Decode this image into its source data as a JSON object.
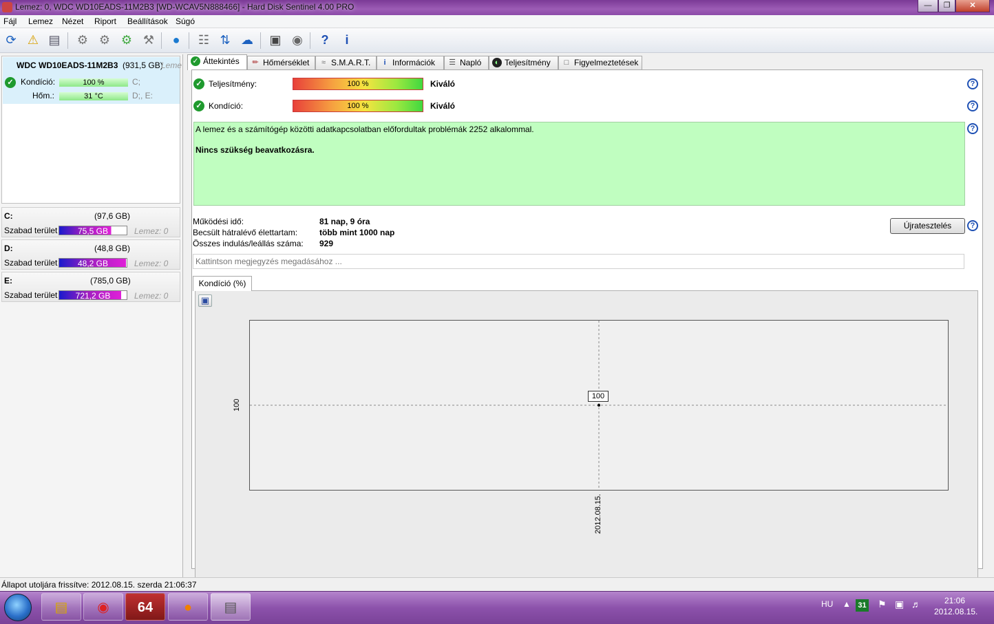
{
  "window": {
    "title": "Lemez: 0, WDC WD10EADS-11M2B3 [WD-WCAV5N888466]  -  Hard Disk Sentinel 4.00 PRO"
  },
  "menu": [
    "Fájl",
    "Lemez",
    "Nézet",
    "Riport",
    "Beállítások",
    "Súgó"
  ],
  "toolbar_icons": [
    "refresh-icon",
    "warning-icon",
    "disk-icon",
    "disk-settings-icon",
    "disk-test-icon",
    "disk-check-icon",
    "disk-repair-icon",
    "globe-icon",
    "report-icon",
    "sync-icon",
    "network-icon",
    "monitor-icon",
    "sound-icon",
    "help-icon",
    "info-icon"
  ],
  "disk": {
    "name": "WDC WD10EADS-11M2B3",
    "size": "(931,5 GB)",
    "size_suffix": "Leme",
    "health_label": "Kondíció:",
    "health_value": "100 %",
    "health_drive": "C;",
    "temp_label": "Hőm.:",
    "temp_value": "31 °C",
    "temp_drives": "D;, E:"
  },
  "drives": [
    {
      "letter": "C:",
      "size": "(97,6 GB)",
      "free_label": "Szabad terület",
      "free": "75,5 GB",
      "disk": "Lemez: 0",
      "free_fraction": 0.77
    },
    {
      "letter": "D:",
      "size": "(48,8 GB)",
      "free_label": "Szabad terület",
      "free": "48,2 GB",
      "disk": "Lemez: 0",
      "free_fraction": 0.99
    },
    {
      "letter": "E:",
      "size": "(785,0 GB)",
      "free_label": "Szabad terület",
      "free": "721,2 GB",
      "disk": "Lemez: 0",
      "free_fraction": 0.92
    }
  ],
  "tabs": [
    "Áttekintés",
    "Hőmérséklet",
    "S.M.A.R.T.",
    "Információk",
    "Napló",
    "Teljesítmény",
    "Figyelmeztetések"
  ],
  "overview": {
    "performance_label": "Teljesítmény:",
    "performance_value": "100 %",
    "performance_rating": "Kiváló",
    "health_label": "Kondíció:",
    "health_value": "100 %",
    "health_rating": "Kiváló",
    "message": "A lemez és a számítógép közötti adatkapcsolatban előfordultak problémák 2252 alkalommal.",
    "recommendation": "Nincs szükség beavatkozásra.",
    "uptime_label": "Működési idő:",
    "uptime_value": "81 nap, 9 óra",
    "lifetime_label": "Becsült hátralévő élettartam:",
    "lifetime_value": "több mint 1000 nap",
    "startstop_label": "Összes indulás/leállás száma:",
    "startstop_value": "929",
    "retest_button": "Újratesztelés",
    "note_placeholder": "Kattintson megjegyzés megadásához ..."
  },
  "chart_tab": "Kondíció  (%)",
  "chart_data": {
    "type": "line",
    "x": [
      "2012.08.15."
    ],
    "series": [
      {
        "values": [
          100
        ]
      }
    ],
    "y_tick_labels": [
      "100"
    ],
    "data_labels": [
      "100"
    ]
  },
  "statusbar": {
    "text": "Állapot utoljára frissítve: 2012.08.15. szerda 21:06:37"
  },
  "taskbar": {
    "language": "HU",
    "clock_time": "21:06",
    "clock_date": "2012.08.15.",
    "calendar_day": "31"
  }
}
